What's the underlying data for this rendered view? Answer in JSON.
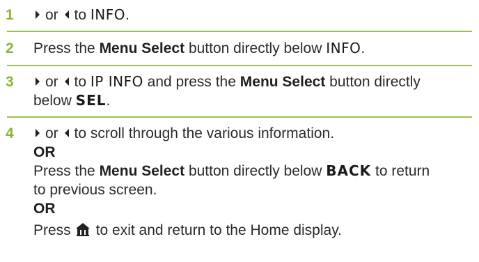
{
  "steps": [
    {
      "number": "1",
      "parts": {
        "or": "or",
        "to": "to",
        "target": "INFO",
        "end": "."
      }
    },
    {
      "number": "2",
      "parts": {
        "press": "Press the",
        "button": "Menu Select",
        "mid": "button directly below",
        "target": "INFO",
        "end": "."
      }
    },
    {
      "number": "3",
      "parts": {
        "or": "or",
        "to": "to",
        "target": "IP INFO",
        "and": "and press the",
        "button": "Menu Select",
        "mid": "button directly",
        "below": "below",
        "sel": "SEL",
        "end": "."
      }
    },
    {
      "number": "4",
      "parts": {
        "or": "or",
        "scroll": "to scroll through the various information.",
        "or_word_1": "OR",
        "press": "Press the",
        "button": "Menu Select",
        "mid": "button directly below",
        "back": "BACK",
        "return": "to return",
        "prev": "to previous screen.",
        "or_word_2": "OR",
        "press2": "Press",
        "home_text": "to exit and return to the Home display."
      }
    }
  ],
  "icons": {
    "right_arrow": "right-arrow-icon",
    "left_arrow": "left-arrow-icon",
    "home": "home-icon"
  },
  "colors": {
    "step_number": "#8cb43c",
    "rule": "#9bbf57",
    "text": "#2a2a2a"
  }
}
